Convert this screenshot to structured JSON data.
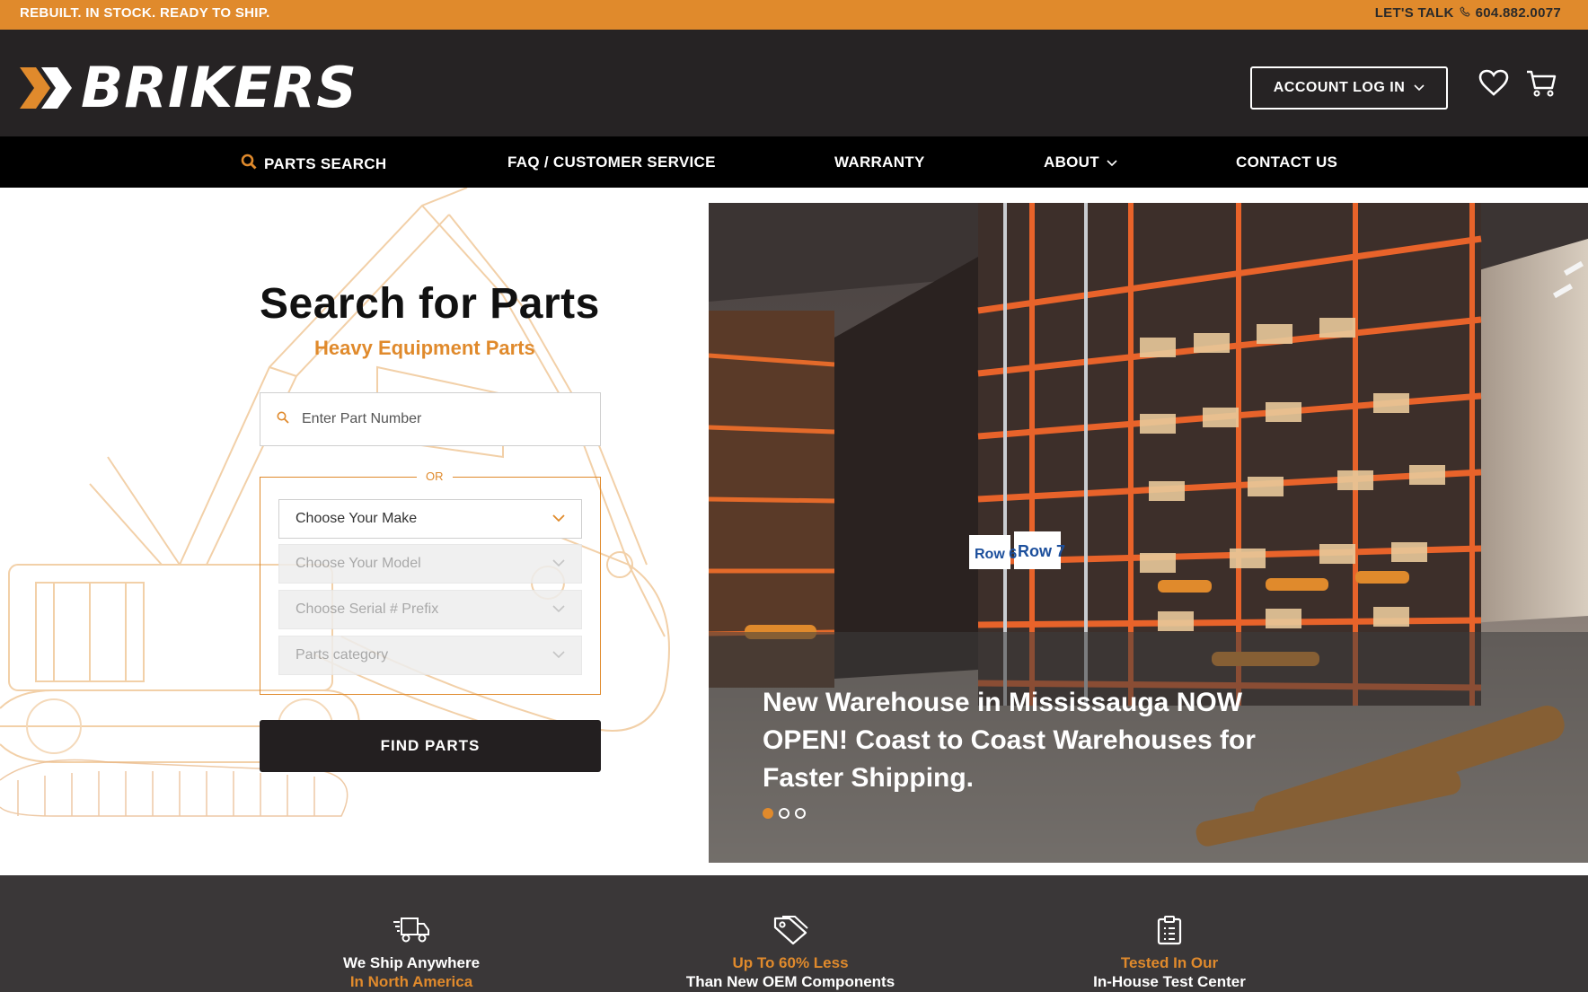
{
  "topbar": {
    "tagline": "REBUILT. IN STOCK. READY TO SHIP.",
    "talk_label": "LET'S TALK",
    "phone": "604.882.0077"
  },
  "header": {
    "logo_text": "BRIKERS",
    "account_button": "ACCOUNT LOG IN"
  },
  "nav": {
    "items": [
      {
        "label": "PARTS SEARCH"
      },
      {
        "label": "FAQ / CUSTOMER SERVICE"
      },
      {
        "label": "WARRANTY"
      },
      {
        "label": "ABOUT"
      },
      {
        "label": "CONTACT US"
      }
    ]
  },
  "search": {
    "title": "Search for Parts",
    "subtitle": "Heavy Equipment Parts",
    "part_placeholder": "Enter Part Number",
    "or_label": "OR",
    "selects": [
      {
        "label": "Choose Your Make"
      },
      {
        "label": "Choose Your Model"
      },
      {
        "label": "Choose Serial # Prefix"
      },
      {
        "label": "Parts category"
      }
    ],
    "find_button": "FIND PARTS"
  },
  "hero": {
    "caption": "New Warehouse in Mississauga NOW OPEN! Coast to Coast Warehouses for Faster Shipping.",
    "slide_count": 3,
    "active_slide": 1,
    "row_labels": [
      "Row 6",
      "Row 7"
    ]
  },
  "features": [
    {
      "icon": "truck-icon",
      "line1": "We Ship Anywhere",
      "line2": "In North America"
    },
    {
      "icon": "tag-icon",
      "line1": "Up To 60% Less",
      "line2": "Than New OEM Components"
    },
    {
      "icon": "clipboard-icon",
      "line1": "Tested In Our",
      "line2": "In-House Test Center"
    }
  ],
  "colors": {
    "accent": "#e08a2c",
    "header_bg": "#262324",
    "nav_bg": "#000000",
    "features_bg": "#3a3738"
  }
}
